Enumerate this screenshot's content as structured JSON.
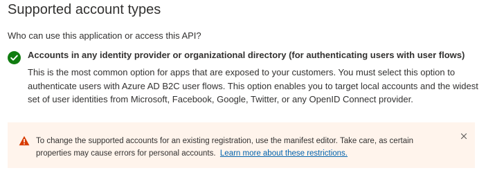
{
  "section": {
    "title": "Supported account types",
    "question": "Who can use this application or access this API?"
  },
  "option": {
    "icon": "checkmark-circle-icon",
    "status_color": "#107c10",
    "title": "Accounts in any identity provider or organizational directory (for authenticating users with user flows)",
    "description": "This is the most common option for apps that are exposed to your customers. You must select this option to authenticate users with Azure AD B2C user flows. This option enables you to target local accounts and the widest set of user identities from Microsoft, Facebook, Google, Twitter, or any OpenID Connect provider."
  },
  "warning": {
    "icon": "warning-icon",
    "icon_color": "#d83b01",
    "background": "#fff4ec",
    "text": "To change the supported accounts for an existing registration, use the manifest editor. Take care, as certain properties may cause errors for personal accounts.",
    "link_label": "Learn more about these restrictions.",
    "close_icon": "close-icon"
  }
}
